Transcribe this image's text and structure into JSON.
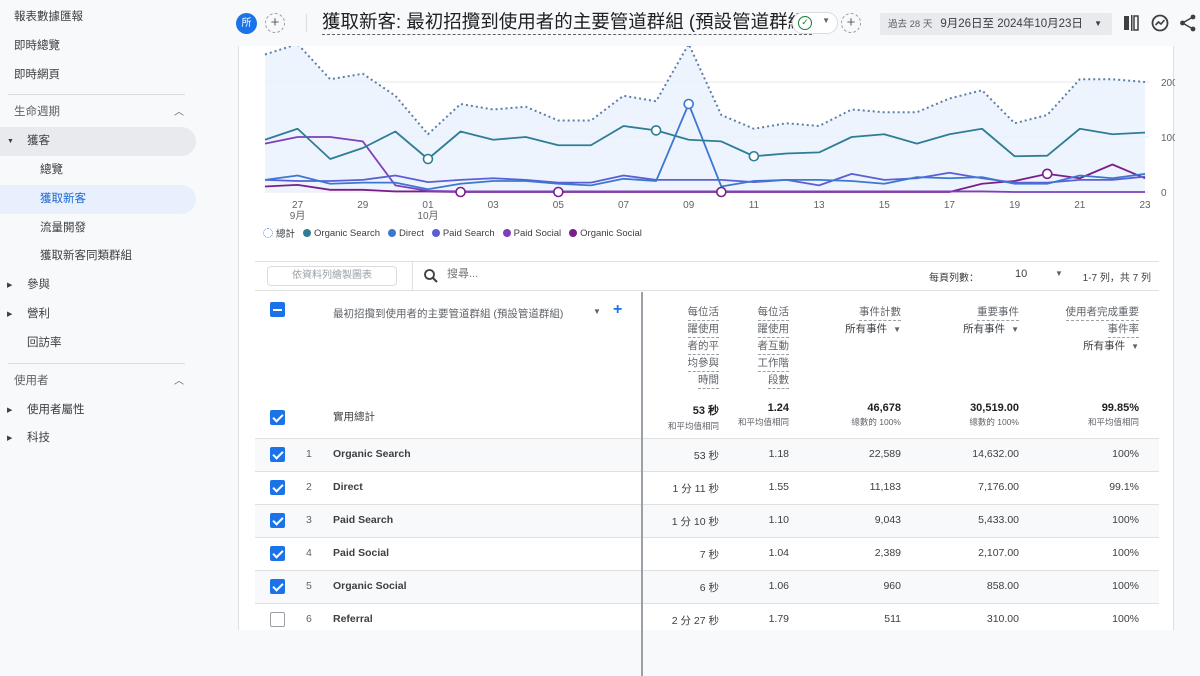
{
  "sidebar": {
    "top_items": [
      "報表數據匯報",
      "即時總覽",
      "即時網頁"
    ],
    "lifecycle": {
      "label": "生命週期",
      "acquisition": {
        "label": "獲客",
        "children": [
          "總覽",
          "獲取新客",
          "流量開發",
          "獲取新客同類群組"
        ]
      },
      "engagement": "參與",
      "monetization": "營利",
      "retention": "回訪率"
    },
    "users": {
      "label": "使用者",
      "attributes": "使用者屬性",
      "tech": "科技"
    }
  },
  "header": {
    "segment_badge": "所",
    "title": "獲取新客: 最初招攬到使用者的主要管道群組 (預設管道群組)",
    "date_prefix": "過去 28 天",
    "date_range": "9月26日至 2024年10月23日"
  },
  "colors": {
    "total": "#5b7fa6",
    "organic_search": "#2f7d95",
    "direct": "#3c78d0",
    "paid_search": "#5a5fd6",
    "paid_social": "#7e3fb8",
    "organic_social": "#7a1f8a",
    "accent": "#1a73e8"
  },
  "chart_data": {
    "type": "line",
    "x": [
      "09-26",
      "09-27",
      "09-28",
      "09-29",
      "09-30",
      "10-01",
      "10-02",
      "10-03",
      "10-04",
      "10-05",
      "10-06",
      "10-07",
      "10-08",
      "10-09",
      "10-10",
      "10-11",
      "10-12",
      "10-13",
      "10-14",
      "10-15",
      "10-16",
      "10-17",
      "10-18",
      "10-19",
      "10-20",
      "10-21",
      "10-22",
      "10-23"
    ],
    "x_tick_labels": [
      {
        "label": "27",
        "sub": "9月",
        "index": 1
      },
      {
        "label": "29",
        "sub": "",
        "index": 3
      },
      {
        "label": "01",
        "sub": "10月",
        "index": 5
      },
      {
        "label": "03",
        "sub": "",
        "index": 7
      },
      {
        "label": "05",
        "sub": "",
        "index": 9
      },
      {
        "label": "07",
        "sub": "",
        "index": 11
      },
      {
        "label": "09",
        "sub": "",
        "index": 13
      },
      {
        "label": "11",
        "sub": "",
        "index": 15
      },
      {
        "label": "13",
        "sub": "",
        "index": 17
      },
      {
        "label": "15",
        "sub": "",
        "index": 19
      },
      {
        "label": "17",
        "sub": "",
        "index": 21
      },
      {
        "label": "19",
        "sub": "",
        "index": 23
      },
      {
        "label": "21",
        "sub": "",
        "index": 25
      },
      {
        "label": "23",
        "sub": "",
        "index": 27
      }
    ],
    "y_ticks": [
      0,
      100,
      200
    ],
    "ylim": [
      0,
      250
    ],
    "grid": true,
    "legend_position": "bottom-left",
    "series": [
      {
        "name": "總計",
        "key": "total",
        "style": "dotted",
        "values": [
          250,
          275,
          205,
          215,
          175,
          105,
          160,
          150,
          155,
          130,
          130,
          175,
          165,
          280,
          140,
          115,
          125,
          120,
          150,
          145,
          145,
          170,
          185,
          125,
          140,
          205,
          205,
          200
        ]
      },
      {
        "name": "Organic Search",
        "key": "organic_search",
        "values": [
          95,
          115,
          60,
          80,
          110,
          60,
          110,
          95,
          100,
          85,
          85,
          120,
          112,
          95,
          92,
          65,
          70,
          72,
          100,
          105,
          88,
          105,
          115,
          65,
          66,
          115,
          105,
          108
        ]
      },
      {
        "name": "Direct",
        "key": "direct",
        "values": [
          22,
          30,
          15,
          17,
          17,
          5,
          15,
          20,
          20,
          15,
          12,
          24,
          20,
          160,
          10,
          20,
          22,
          22,
          20,
          15,
          27,
          25,
          27,
          15,
          15,
          30,
          25,
          33
        ]
      },
      {
        "name": "Paid Search",
        "key": "paid_search",
        "values": [
          22,
          20,
          20,
          22,
          30,
          18,
          22,
          25,
          22,
          17,
          17,
          30,
          22,
          22,
          22,
          18,
          22,
          12,
          33,
          22,
          25,
          35,
          25,
          17,
          17,
          22,
          22,
          28
        ]
      },
      {
        "name": "Paid Social",
        "key": "paid_social",
        "values": [
          88,
          100,
          100,
          92,
          12,
          2,
          1,
          1,
          1,
          1,
          1,
          1,
          1,
          1,
          1,
          1,
          1,
          1,
          1,
          1,
          1,
          1,
          1,
          0,
          0,
          0,
          0,
          0
        ]
      },
      {
        "name": "Organic Social",
        "key": "organic_social",
        "values": [
          10,
          13,
          4,
          4,
          1,
          1,
          0,
          0,
          0,
          0,
          0,
          0,
          0,
          0,
          0,
          0,
          0,
          0,
          0,
          0,
          0,
          0,
          15,
          20,
          33,
          25,
          50,
          25
        ]
      }
    ],
    "markers": [
      {
        "series": "organic_search",
        "index": 5
      },
      {
        "series": "organic_search",
        "index": 12
      },
      {
        "series": "organic_search",
        "index": 15
      },
      {
        "series": "direct",
        "index": 13
      },
      {
        "series": "organic_social",
        "index": 6
      },
      {
        "series": "organic_social",
        "index": 9
      },
      {
        "series": "organic_social",
        "index": 14
      },
      {
        "series": "organic_social",
        "index": 24
      }
    ]
  },
  "table_toolbar": {
    "plot_rows_label": "依資料列繪製圖表",
    "search_placeholder": "搜尋...",
    "rows_per_page_label": "每頁列數：",
    "rows_per_page": "10",
    "pager": "1-7 列，共 7 列"
  },
  "table": {
    "dimension_header": "最初招攬到使用者的主要管道群組 (預設管道群組)",
    "columns": [
      {
        "lines": [
          "每位活",
          "躍使用",
          "者的平",
          "均參與",
          "時間"
        ],
        "selector": ""
      },
      {
        "lines": [
          "每位活",
          "躍使用",
          "者互動",
          "工作階",
          "段數"
        ],
        "selector": ""
      },
      {
        "lines": [
          "事件計數"
        ],
        "selector": "所有事件"
      },
      {
        "lines": [
          "重要事件"
        ],
        "selector": "所有事件"
      },
      {
        "lines": [
          "使用者完成重要",
          "事件率"
        ],
        "selector": "所有事件"
      }
    ],
    "totals": {
      "label": "實用總計",
      "values": [
        "53 秒",
        "1.24",
        "46,678",
        "30,519.00",
        "99.85%"
      ],
      "subs": [
        "和平均值相同",
        "和平均值相同",
        "總數的 100%",
        "總數的 100%",
        "和平均值相同"
      ]
    },
    "rows": [
      {
        "index": "1",
        "name": "Organic Search",
        "checked": true,
        "values": [
          "53 秒",
          "1.18",
          "22,589",
          "14,632.00",
          "100%"
        ]
      },
      {
        "index": "2",
        "name": "Direct",
        "checked": true,
        "values": [
          "1 分 11 秒",
          "1.55",
          "11,183",
          "7,176.00",
          "99.1%"
        ]
      },
      {
        "index": "3",
        "name": "Paid Search",
        "checked": true,
        "values": [
          "1 分 10 秒",
          "1.10",
          "9,043",
          "5,433.00",
          "100%"
        ]
      },
      {
        "index": "4",
        "name": "Paid Social",
        "checked": true,
        "values": [
          "7 秒",
          "1.04",
          "2,389",
          "2,107.00",
          "100%"
        ]
      },
      {
        "index": "5",
        "name": "Organic Social",
        "checked": true,
        "values": [
          "6 秒",
          "1.06",
          "960",
          "858.00",
          "100%"
        ]
      },
      {
        "index": "6",
        "name": "Referral",
        "checked": false,
        "values": [
          "2 分 27 秒",
          "1.79",
          "511",
          "310.00",
          "100%"
        ]
      }
    ]
  }
}
